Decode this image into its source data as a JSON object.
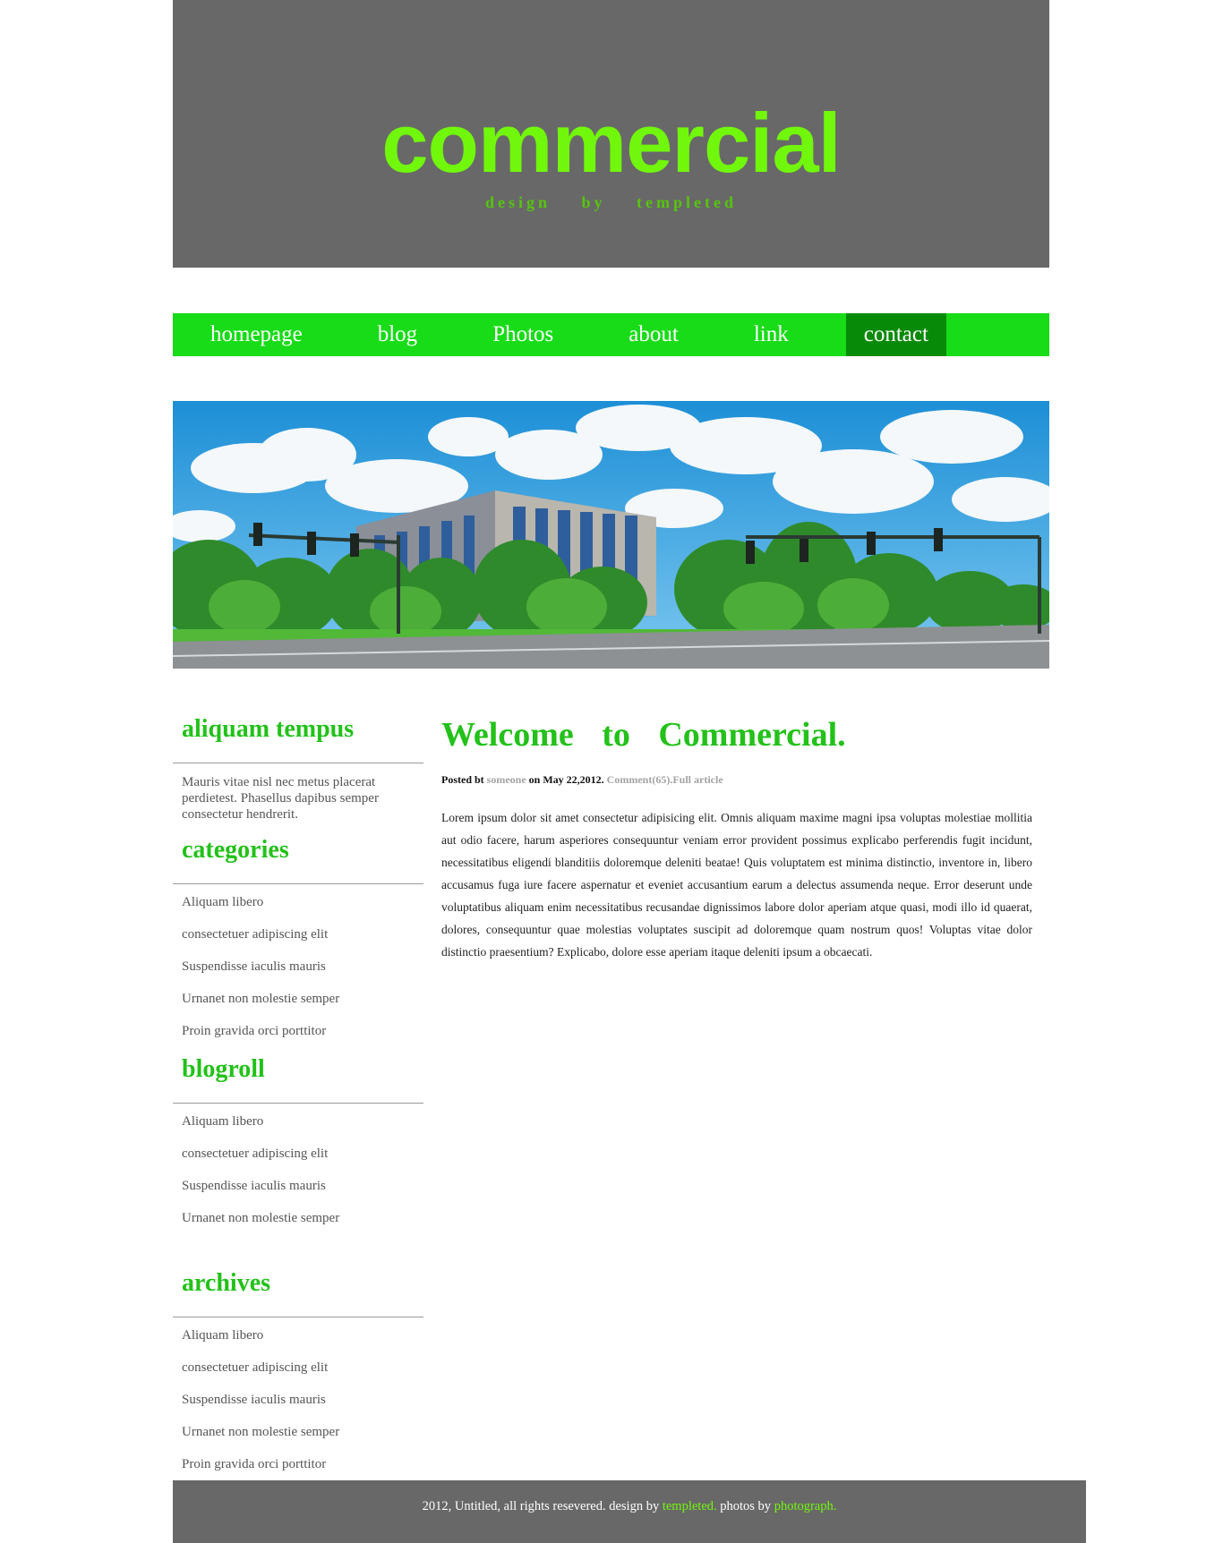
{
  "header": {
    "logo": "commercial",
    "tagline": "design by templeted"
  },
  "menu": {
    "items": [
      {
        "label": "homepage"
      },
      {
        "label": "blog"
      },
      {
        "label": "Photos"
      },
      {
        "label": "about"
      },
      {
        "label": "link"
      },
      {
        "label": "contact",
        "active": true
      }
    ]
  },
  "sidebar": {
    "aliquam": {
      "title": "aliquam tempus",
      "text": "Mauris vitae nisl nec metus placerat perdietest. Phasellus dapibus semper consectetur hendrerit."
    },
    "categories": {
      "title": "categories",
      "items": [
        "Aliquam libero",
        "consectetuer adipiscing elit",
        "Suspendisse iaculis mauris",
        "Urnanet non molestie semper",
        "Proin gravida orci porttitor"
      ]
    },
    "blogroll": {
      "title": "blogroll",
      "items": [
        "Aliquam libero",
        "consectetuer adipiscing elit",
        "Suspendisse iaculis mauris",
        "Urnanet non molestie semper"
      ]
    },
    "archives": {
      "title": "archives",
      "items": [
        "Aliquam libero",
        "consectetuer adipiscing elit",
        "Suspendisse iaculis mauris",
        "Urnanet non molestie semper",
        "Proin gravida orci porttitor"
      ]
    }
  },
  "post": {
    "title": "Welcome to Commercial.",
    "meta": {
      "prefix": "Posted bt ",
      "author": "someone",
      "date_text": " on May 22,2012. ",
      "comments": "Comment(65).",
      "full_article": "Full article"
    },
    "body": "Lorem ipsum dolor sit amet consectetur adipisicing elit. Omnis aliquam maxime magni ipsa voluptas molestiae mollitia aut odio facere, harum asperiores consequuntur veniam error provident possimus explicabo perferendis fugit incidunt, necessitatibus eligendi blanditiis doloremque deleniti beatae! Quis voluptatem est minima distinctio, inventore in, libero accusamus fuga iure facere aspernatur et eveniet accusantium earum a delectus assumenda neque. Error deserunt unde voluptatibus aliquam enim necessitatibus recusandae dignissimos labore dolor aperiam atque quasi, modi illo id quaerat, dolores, consequuntur quae molestias voluptates suscipit ad doloremque quam nostrum quos! Voluptas vitae dolor distinctio praesentium? Explicabo, dolore esse aperiam itaque deleniti ipsum a obcaecati."
  },
  "footer": {
    "text": "2012, Untitled, all rights resevered. design by ",
    "templeted": "templeted.",
    "photos_by": " photos by ",
    "photograph": "photograph."
  },
  "colors": {
    "header_bg": "#686868",
    "logo": "#71f70b",
    "menu_bg": "#17dc17",
    "menu_active": "#078a07",
    "heading": "#23c11a"
  }
}
